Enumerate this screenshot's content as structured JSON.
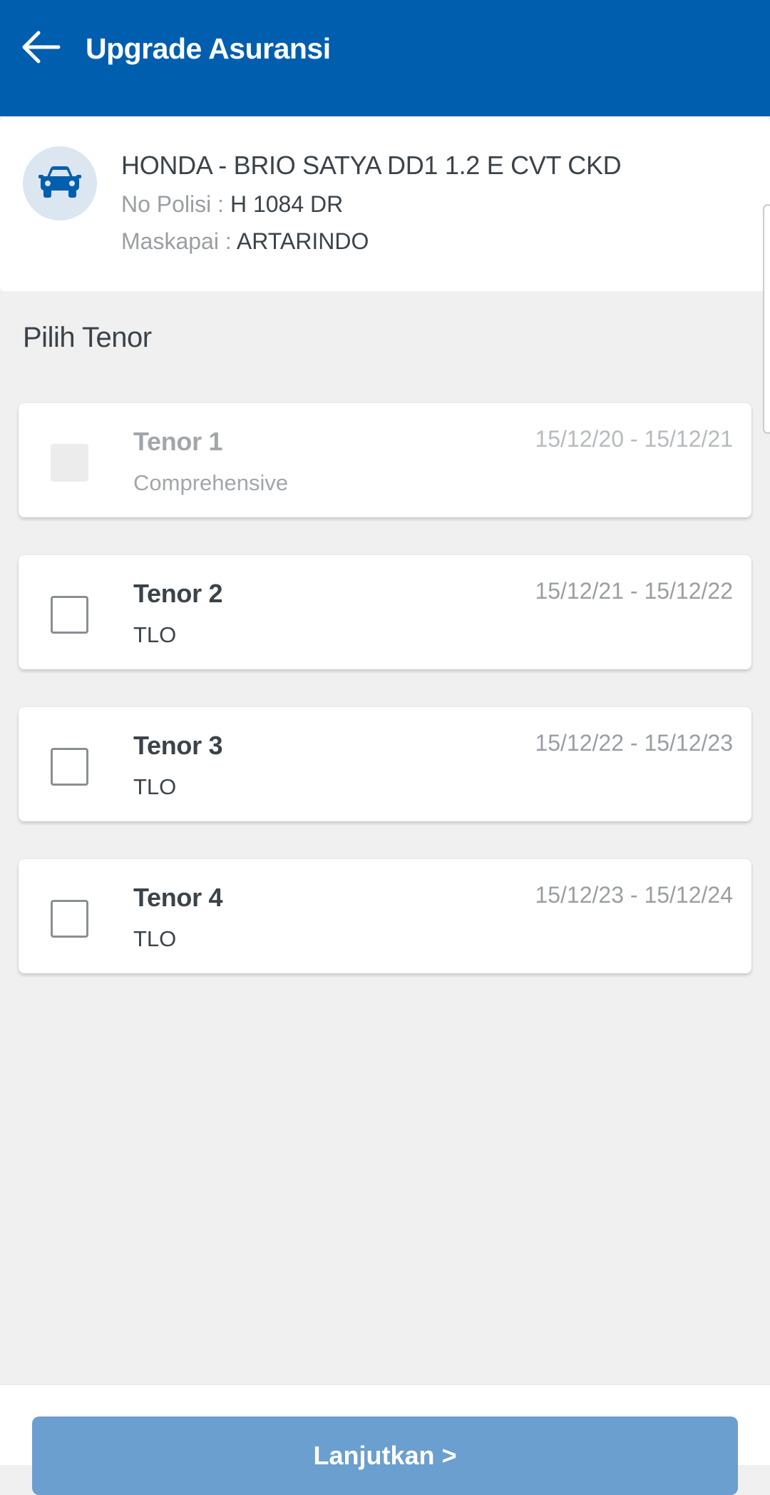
{
  "header": {
    "title": "Upgrade Asuransi",
    "back_icon": "arrow-left-icon",
    "background_color": "#005eae"
  },
  "vehicle": {
    "icon": "car-icon",
    "name": "HONDA - BRIO SATYA DD1 1.2 E CVT CKD",
    "polisi_label": "No Polisi : ",
    "polisi_value": "H 1084 DR",
    "maskapai_label": "Maskapai : ",
    "maskapai_value": "ARTARINDO"
  },
  "section": {
    "title": "Pilih Tenor"
  },
  "tenors": [
    {
      "title": "Tenor 1",
      "type": "Comprehensive",
      "period": "15/12/20 - 15/12/21",
      "disabled": true,
      "checked": false
    },
    {
      "title": "Tenor 2",
      "type": "TLO",
      "period": "15/12/21 - 15/12/22",
      "disabled": false,
      "checked": false
    },
    {
      "title": "Tenor 3",
      "type": "TLO",
      "period": "15/12/22 - 15/12/23",
      "disabled": false,
      "checked": false
    },
    {
      "title": "Tenor 4",
      "type": "TLO",
      "period": "15/12/23 - 15/12/24",
      "disabled": false,
      "checked": false
    }
  ],
  "footer": {
    "continue_label": "Lanjutkan >",
    "button_color": "#6a9fcf"
  }
}
